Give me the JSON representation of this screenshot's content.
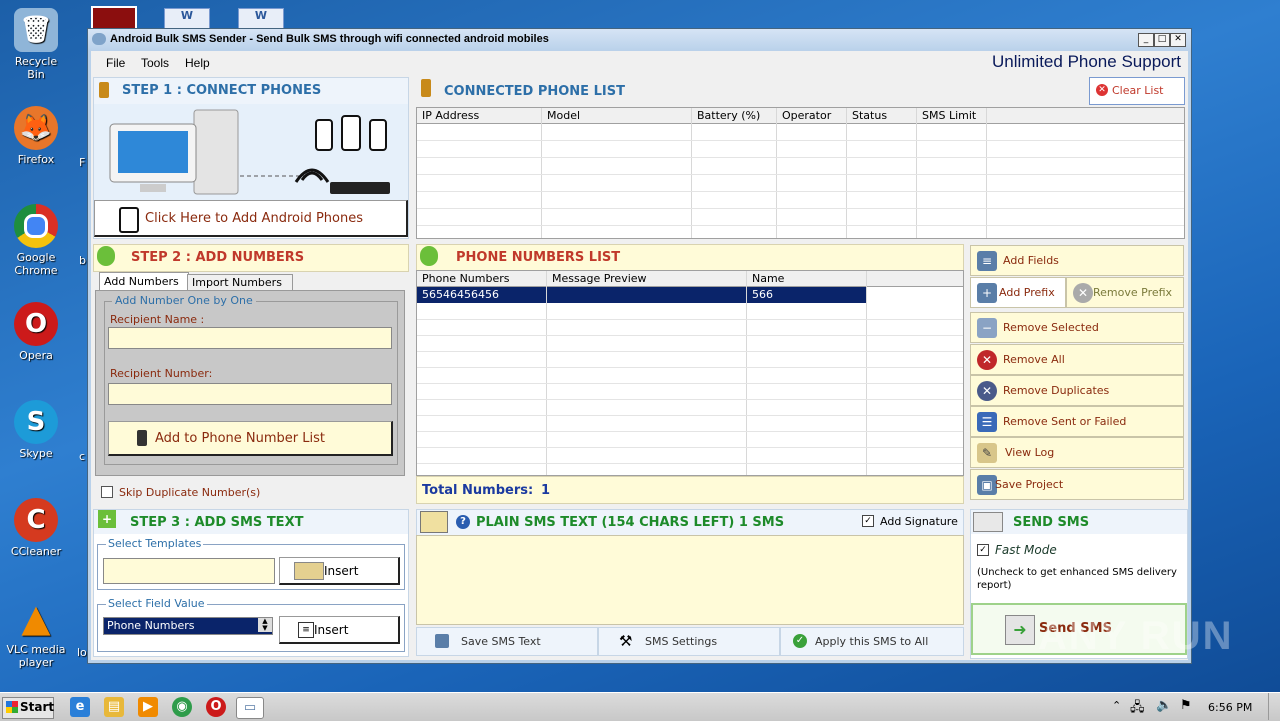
{
  "desktop": {
    "icons": [
      {
        "label": "Recycle Bin",
        "glyph": "🗑",
        "bg": "#8fb5d8"
      },
      {
        "label": "Firefox",
        "glyph": "🦊",
        "bg": "#e8762a"
      },
      {
        "label": "Google Chrome",
        "glyph": "◉",
        "bg": "#2e9c4a"
      },
      {
        "label": "Opera",
        "glyph": "O",
        "bg": "#cc1a1a"
      },
      {
        "label": "Skype",
        "glyph": "S",
        "bg": "#1d9bd8"
      },
      {
        "label": "CCleaner",
        "glyph": "C",
        "bg": "#d53a1f"
      },
      {
        "label": "VLC media player",
        "glyph": "▲",
        "bg": "#f08a00"
      }
    ],
    "peek_labels": [
      "F",
      "b",
      "c",
      "lo"
    ]
  },
  "window": {
    "title": "Android Bulk SMS Sender - Send Bulk SMS through wifi connected android mobiles",
    "menu": [
      "File",
      "Tools",
      "Help"
    ],
    "support": "Unlimited Phone Support"
  },
  "step1": {
    "title": "STEP 1 : CONNECT PHONES",
    "add_phones_button": "Click Here to Add Android Phones"
  },
  "connected": {
    "title": "CONNECTED PHONE LIST",
    "clear_button": "Clear List",
    "columns": [
      "IP Address",
      "Model",
      "Battery (%)",
      "Operator",
      "Status",
      "SMS Limit"
    ]
  },
  "step2": {
    "title": "STEP 2 : ADD NUMBERS",
    "tabs": [
      "Add Numbers",
      "Import Numbers"
    ],
    "group_label": "Add Number One by One",
    "recipient_name_label": "Recipient Name :",
    "recipient_name_value": "",
    "recipient_number_label": "Recipient Number:",
    "recipient_number_value": "",
    "add_button": "Add to Phone Number List",
    "skip_duplicates": "Skip Duplicate Number(s)"
  },
  "phone_list": {
    "title": "PHONE NUMBERS LIST",
    "columns": [
      "Phone Numbers",
      "Message Preview",
      "Name"
    ],
    "rows": [
      {
        "number": "56546456456",
        "preview": "",
        "name": "566"
      }
    ],
    "total_label": "Total Numbers:",
    "total_value": "1"
  },
  "side_actions": {
    "add_fields": "Add Fields",
    "add_prefix": "Add Prefix",
    "remove_prefix": "Remove Prefix",
    "remove_selected": "Remove Selected",
    "remove_all": "Remove All",
    "remove_duplicates": "Remove Duplicates",
    "remove_sent_failed": "Remove Sent or Failed",
    "view_log": "View Log",
    "save_project": "Save Project"
  },
  "step3": {
    "title": "STEP 3 : ADD SMS TEXT",
    "templates_label": "Select Templates",
    "templates_value": "",
    "insert1": "Insert",
    "field_label": "Select Field Value",
    "field_value": "Phone Numbers",
    "insert2": "Insert"
  },
  "sms_text": {
    "title": "PLAIN SMS TEXT (154 CHARS LEFT) 1 SMS",
    "add_signature": "Add Signature",
    "body": "",
    "save_button": "Save SMS Text",
    "settings_button": "SMS Settings",
    "apply_button": "Apply this SMS to All"
  },
  "send": {
    "title": "SEND SMS",
    "fast_mode": "Fast Mode",
    "note": "(Uncheck to get enhanced SMS delivery report)",
    "button": "Send SMS"
  },
  "taskbar": {
    "start": "Start",
    "clock": "6:56 PM"
  },
  "watermark": "ANY RUN"
}
